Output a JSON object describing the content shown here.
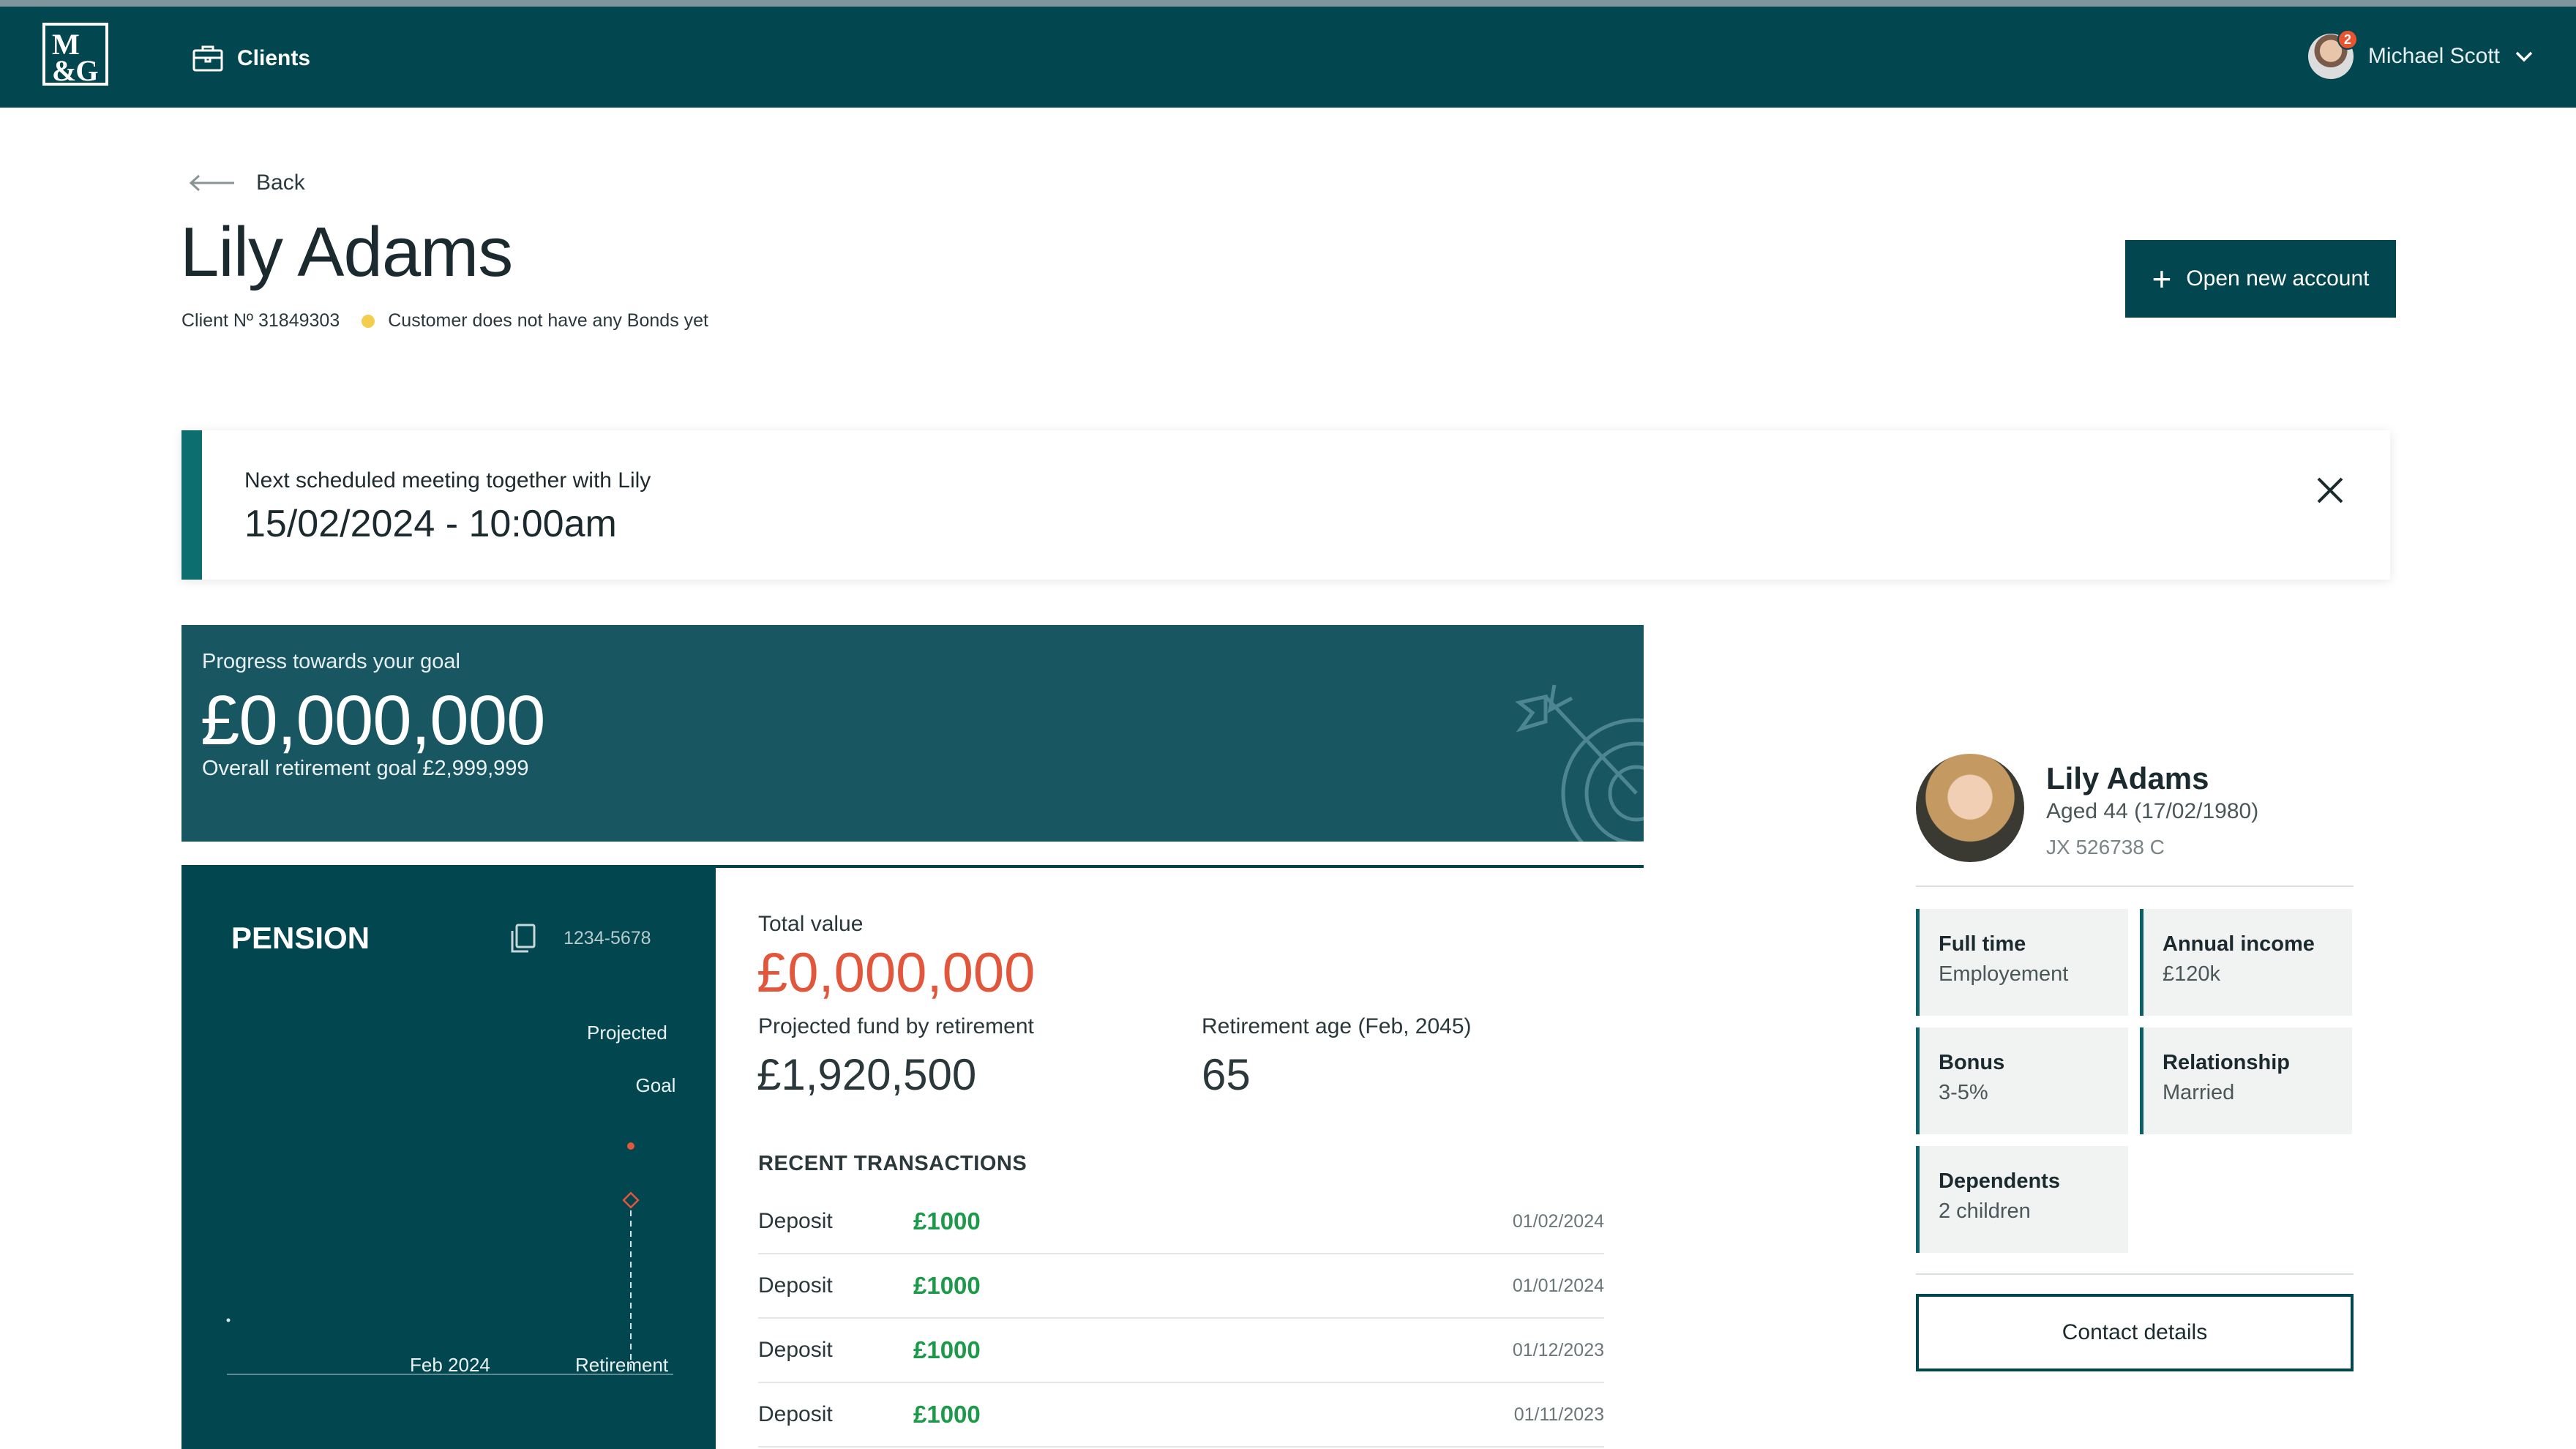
{
  "header": {
    "logo_line1": "M",
    "logo_line2": "&G",
    "nav_clients": "Clients",
    "user_name": "Michael Scott",
    "notification_count": "2"
  },
  "page": {
    "back_label": "Back",
    "client_name": "Lily Adams",
    "client_number": "Client Nº 31849303",
    "bonds_status": "Customer does not have any Bonds yet",
    "open_account_label": "Open new account"
  },
  "meeting": {
    "label": "Next scheduled meeting together with Lily",
    "datetime": "15/02/2024 - 10:00am"
  },
  "goal": {
    "label": "Progress towards your goal",
    "amount": "£0,000,000",
    "overall": "Overall retirement goal £2,999,999"
  },
  "pension": {
    "title": "PENSION",
    "account_number": "1234-5678",
    "chart": {
      "projected_label": "Projected",
      "goal_label": "Goal",
      "x_tick_start": "Feb 2024",
      "x_tick_end": "Retirement"
    },
    "total_value_label": "Total value",
    "total_value": "£0,000,000",
    "projected_label": "Projected fund by retirement",
    "projected_value": "£1,920,500",
    "retirement_age_label": "Retirement age (Feb, 2045)",
    "retirement_age_value": "65",
    "recent_title": "RECENT TRANSACTIONS",
    "transactions": [
      {
        "type": "Deposit",
        "amount": "£1000",
        "date": "01/02/2024"
      },
      {
        "type": "Deposit",
        "amount": "£1000",
        "date": "01/01/2024"
      },
      {
        "type": "Deposit",
        "amount": "£1000",
        "date": "01/12/2023"
      },
      {
        "type": "Deposit",
        "amount": "£1000",
        "date": "01/11/2023"
      }
    ]
  },
  "profile": {
    "name": "Lily Adams",
    "age": "Aged 44 (17/02/1980)",
    "ni_number": "JX 526738 C",
    "tiles": [
      {
        "title": "Full time",
        "value": "Employement"
      },
      {
        "title": "Annual income",
        "value": "£120k"
      },
      {
        "title": "Bonus",
        "value": "3-5%"
      },
      {
        "title": "Relationship",
        "value": "Married"
      },
      {
        "title": "Dependents",
        "value": "2 children"
      }
    ],
    "contact_label": "Contact details"
  },
  "colors": {
    "brand": "#02464f",
    "accent_orange": "#e2573b",
    "positive": "#1c9a4a",
    "status_dot": "#f3cd4d"
  }
}
